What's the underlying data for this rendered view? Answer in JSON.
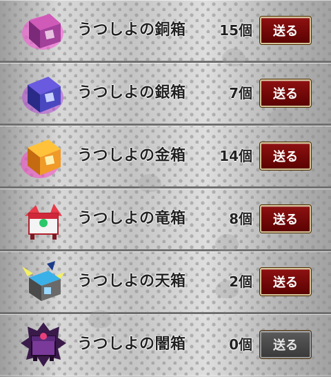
{
  "items": [
    {
      "name": "うつしよの銅箱",
      "count": "15個",
      "button": "送る",
      "enabled": true,
      "icon": "copper-chest-icon",
      "color": "#c43aa8"
    },
    {
      "name": "うつしよの銀箱",
      "count": "7個",
      "button": "送る",
      "enabled": true,
      "icon": "silver-chest-icon",
      "color": "#5a4ac8"
    },
    {
      "name": "うつしよの金箱",
      "count": "14個",
      "button": "送る",
      "enabled": true,
      "icon": "gold-chest-icon",
      "color": "#f0a028"
    },
    {
      "name": "うつしよの竜箱",
      "count": "8個",
      "button": "送る",
      "enabled": true,
      "icon": "dragon-chest-icon",
      "color": "#d02a3a"
    },
    {
      "name": "うつしよの天箱",
      "count": "2個",
      "button": "送る",
      "enabled": true,
      "icon": "heaven-chest-icon",
      "color": "#2aa0d8"
    },
    {
      "name": "うつしよの闇箱",
      "count": "0個",
      "button": "送る",
      "enabled": false,
      "icon": "dark-chest-icon",
      "color": "#6a2a8a"
    }
  ]
}
